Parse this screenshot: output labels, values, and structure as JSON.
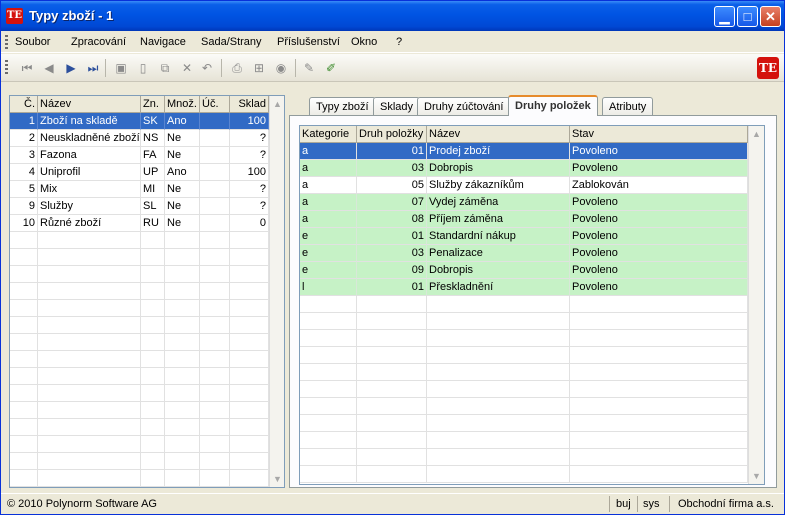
{
  "window": {
    "title": "Typy zboží - 1",
    "app_icon_text": "TE",
    "minimize_symbol": "▁",
    "maximize_symbol": "□",
    "close_symbol": "✕"
  },
  "menu": {
    "items": [
      "Soubor",
      "Zpracování",
      "Navigace",
      "Sada/Strany",
      "Příslušenství",
      "Okno",
      "?"
    ]
  },
  "toolbar": {
    "icons": [
      "first-record-icon",
      "previous-record-icon",
      "next-record-icon",
      "last-record-icon",
      "save-icon",
      "new-document-icon",
      "copy-icon",
      "delete-icon",
      "undo-icon",
      "print-icon",
      "tree-icon",
      "refresh-icon",
      "edit-pencil-icon",
      "marker-icon"
    ],
    "logo_text": "TE"
  },
  "left_grid": {
    "columns": [
      "Č.",
      "Název",
      "Zn.",
      "Množ.",
      "Úč.",
      "Sklad"
    ],
    "rows": [
      {
        "no": "1",
        "name": "Zboží na skladě",
        "code": "SK",
        "qty": "Ano",
        "acc": "",
        "stock": "100"
      },
      {
        "no": "2",
        "name": "Neuskladněné zboží",
        "code": "NS",
        "qty": "Ne",
        "acc": "",
        "stock": "?"
      },
      {
        "no": "3",
        "name": "Fazona",
        "code": "FA",
        "qty": "Ne",
        "acc": "",
        "stock": "?"
      },
      {
        "no": "4",
        "name": "Uniprofil",
        "code": "UP",
        "qty": "Ano",
        "acc": "",
        "stock": "100"
      },
      {
        "no": "5",
        "name": "Mix",
        "code": "MI",
        "qty": "Ne",
        "acc": "",
        "stock": "?"
      },
      {
        "no": "9",
        "name": "Služby",
        "code": "SL",
        "qty": "Ne",
        "acc": "",
        "stock": "?"
      },
      {
        "no": "10",
        "name": "Různé zboží",
        "code": "RU",
        "qty": "Ne",
        "acc": "",
        "stock": "0"
      }
    ],
    "selected_index": 0
  },
  "tabs": {
    "items": [
      "Typy zboží",
      "Sklady",
      "Druhy zúčtování",
      "Druhy položek",
      "Atributy"
    ],
    "active_index": 3
  },
  "right_grid": {
    "columns": [
      "Kategorie",
      "Druh položky",
      "Název",
      "Stav"
    ],
    "rows": [
      {
        "cat": "a",
        "type": "01",
        "name": "Prodej zboží",
        "state": "Povoleno",
        "style": "selected"
      },
      {
        "cat": "a",
        "type": "03",
        "name": "Dobropis",
        "state": "Povoleno",
        "style": "green"
      },
      {
        "cat": "a",
        "type": "05",
        "name": "Služby zákazníkům",
        "state": "Zablokován",
        "style": "white"
      },
      {
        "cat": "a",
        "type": "07",
        "name": "Vydej záměna",
        "state": "Povoleno",
        "style": "green"
      },
      {
        "cat": "a",
        "type": "08",
        "name": "Příjem záměna",
        "state": "Povoleno",
        "style": "green"
      },
      {
        "cat": "e",
        "type": "01",
        "name": "Standardní nákup",
        "state": "Povoleno",
        "style": "green"
      },
      {
        "cat": "e",
        "type": "03",
        "name": "Penalizace",
        "state": "Povoleno",
        "style": "green"
      },
      {
        "cat": "e",
        "type": "09",
        "name": "Dobropis",
        "state": "Povoleno",
        "style": "green"
      },
      {
        "cat": "l",
        "type": "01",
        "name": "Přeskladnění",
        "state": "Povoleno",
        "style": "green"
      }
    ]
  },
  "status": {
    "copyright": "© 2010 Polynorm Software AG",
    "user": "buj",
    "db": "sys",
    "company": "Obchodní firma a.s."
  },
  "colors": {
    "selection": "#316ac5",
    "green_row": "#c6f2c6",
    "title_bar": "#0054e3",
    "active_tab_accent": "#e68b2c"
  }
}
